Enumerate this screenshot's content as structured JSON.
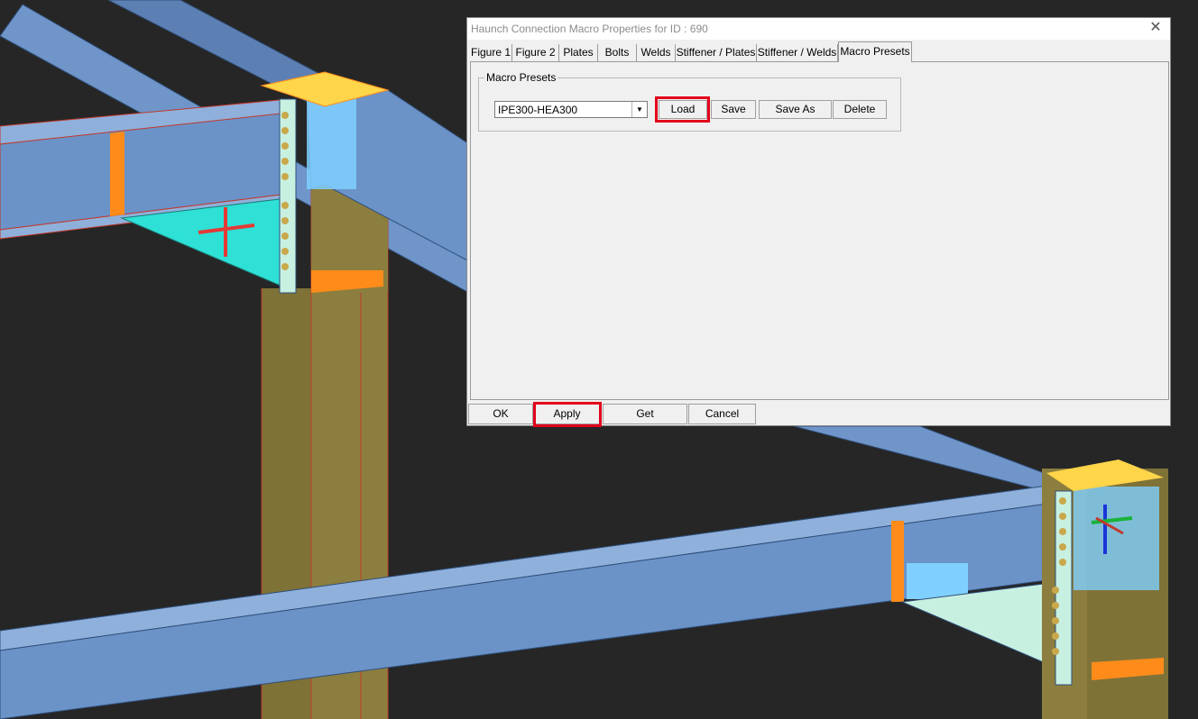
{
  "window": {
    "title": "Haunch Connection Macro Properties for ID : 690",
    "close_glyph": "✕"
  },
  "tabs": [
    {
      "label": "Figure 1"
    },
    {
      "label": "Figure 2"
    },
    {
      "label": "Plates"
    },
    {
      "label": "Bolts"
    },
    {
      "label": "Welds"
    },
    {
      "label": "Stiffener / Plates"
    },
    {
      "label": "Stiffener / Welds"
    },
    {
      "label": "Macro Presets",
      "active": true
    }
  ],
  "macro_presets": {
    "group_label": "Macro Presets",
    "selected_preset": "IPE300-HEA300",
    "dropdown_glyph": "▼",
    "buttons": {
      "load": "Load",
      "save": "Save",
      "save_as": "Save As",
      "delete": "Delete"
    }
  },
  "footer": {
    "ok": "OK",
    "apply": "Apply",
    "get": "Get",
    "cancel": "Cancel"
  },
  "colors": {
    "highlight": "#e3001b",
    "viewport_background": "#262626",
    "beam": "#6b93c8",
    "column": "#8c7e3e",
    "haunch_plate": "#2ee0d6",
    "stiffener": "#ff8c1a"
  }
}
